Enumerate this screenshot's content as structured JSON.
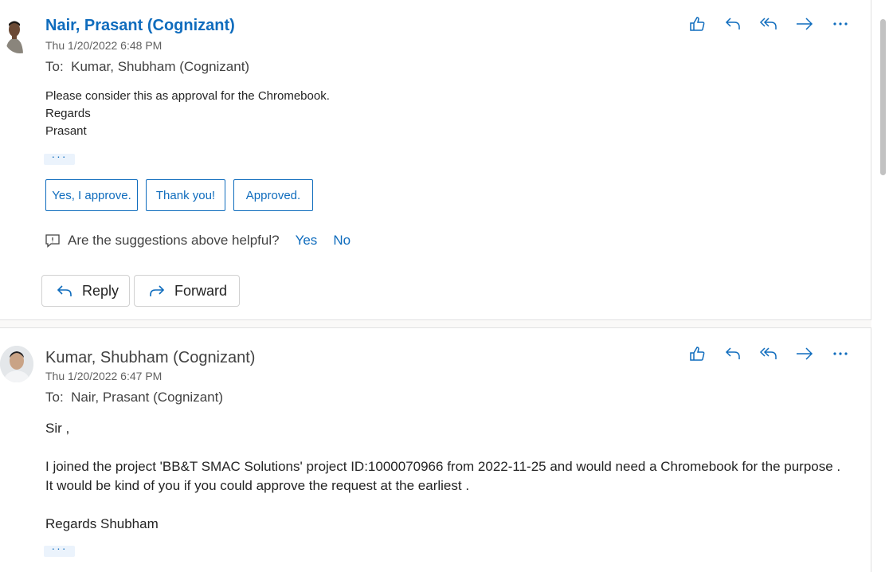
{
  "messages": [
    {
      "sender": "Nair, Prasant (Cognizant)",
      "date": "Thu 1/20/2022 6:48 PM",
      "to_label": "To:",
      "to": "Kumar, Shubham (Cognizant)",
      "body": [
        "Please consider this as approval for the Chromebook.",
        "Regards",
        "Prasant"
      ],
      "more": "···"
    },
    {
      "sender": "Kumar, Shubham (Cognizant)",
      "date": "Thu 1/20/2022 6:47 PM",
      "to_label": "To:",
      "to": "Nair, Prasant (Cognizant)",
      "body": [
        "Sir ,",
        "I joined the project 'BB&T SMAC Solutions' project ID:1000070966 from 2022-11-25 and would need a Chromebook for the purpose . It would be kind of you if you could approve the request at the earliest .",
        "Regards Shubham"
      ],
      "more": "···"
    }
  ],
  "suggestions": [
    "Yes, I approve.",
    "Thank you!",
    "Approved."
  ],
  "feedback": {
    "question": "Are the suggestions above helpful?",
    "yes": "Yes",
    "no": "No"
  },
  "actions": {
    "reply": "Reply",
    "forward": "Forward"
  },
  "toolbar_icons": [
    "like-icon",
    "reply-icon",
    "reply-all-icon",
    "forward-icon",
    "more-actions-icon"
  ],
  "colors": {
    "accent": "#0f6cbd",
    "text": "#242424",
    "muted": "#616161"
  }
}
